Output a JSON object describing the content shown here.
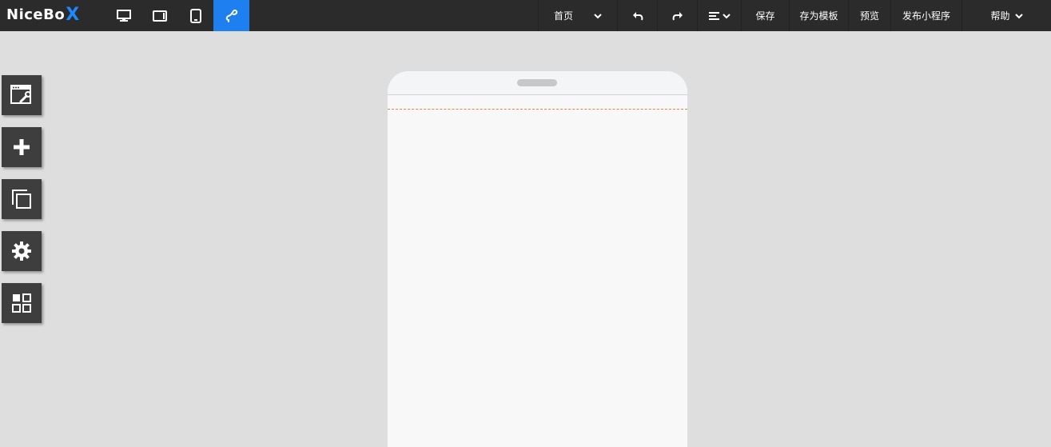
{
  "app": {
    "logo_text": "NiceBo",
    "logo_accent": "X"
  },
  "device_buttons": [
    {
      "icon": "desktop-icon",
      "active": false
    },
    {
      "icon": "tablet-landscape-icon",
      "active": false
    },
    {
      "icon": "tablet-portrait-icon",
      "active": false
    },
    {
      "icon": "link-icon",
      "active": true
    }
  ],
  "header": {
    "page_select": "首页",
    "undo_icon": "undo-icon",
    "redo_icon": "redo-icon",
    "align_icon": "align-icon",
    "save_label": "保存",
    "save_template_label": "存为模板",
    "preview_label": "预览",
    "publish_label": "发布小程序",
    "help_label": "帮助"
  },
  "sidebar_tools": [
    {
      "icon": "page-edit-icon"
    },
    {
      "icon": "add-icon"
    },
    {
      "icon": "copy-icon"
    },
    {
      "icon": "settings-icon"
    },
    {
      "icon": "components-icon"
    }
  ],
  "colors": {
    "topbar_bg": "#2b2b2b",
    "accent": "#1e7ff0",
    "canvas_bg": "#dedede",
    "tool_bg": "#3e3e3e",
    "guide_line": "#e5834a"
  }
}
